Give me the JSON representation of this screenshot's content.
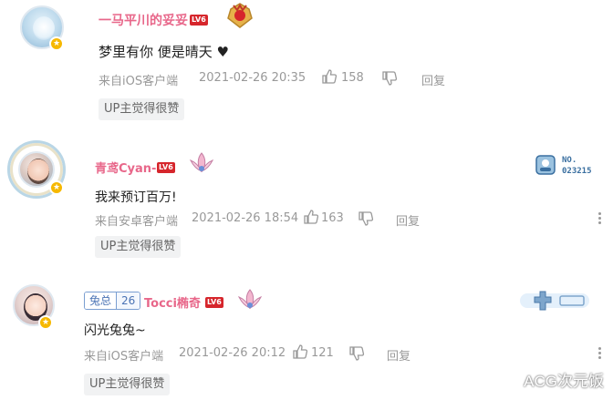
{
  "comments": [
    {
      "username": "一马平川的妥妥",
      "level": "LV6",
      "content": "梦里有你 便是晴天 ♥",
      "source": "来自iOS客户端",
      "time": "2021-02-26 20:35",
      "likes": "158",
      "reply": "回复",
      "tag": "UP主觉得很赞"
    },
    {
      "username": "青鸢Cyan-",
      "level": "LV6",
      "content": "我来预订百万!",
      "source": "来自安卓客户端",
      "time": "2021-02-26 18:54",
      "likes": "163",
      "reply": "回复",
      "tag": "UP主觉得很赞",
      "nft_label": "NO.",
      "nft_number": "023215"
    },
    {
      "fan_medal_name": "兔总",
      "fan_medal_level": "26",
      "username": "Tocci椭奇",
      "level": "LV6",
      "content": "闪光兔兔~",
      "source": "来自iOS客户端",
      "time": "2021-02-26 20:12",
      "likes": "121",
      "reply": "回复",
      "tag": "UP主觉得很赞"
    }
  ],
  "watermark": "ACG次元饭",
  "colors": {
    "username": "#e8678a",
    "level_badge": "#d6262c",
    "meta": "#999999",
    "tag_bg": "#f1f2f3",
    "vip_badge": "#f6b800"
  },
  "icons": {
    "like": "thumbs-up-icon",
    "dislike": "thumbs-down-icon",
    "more": "more-vertical-icon"
  }
}
